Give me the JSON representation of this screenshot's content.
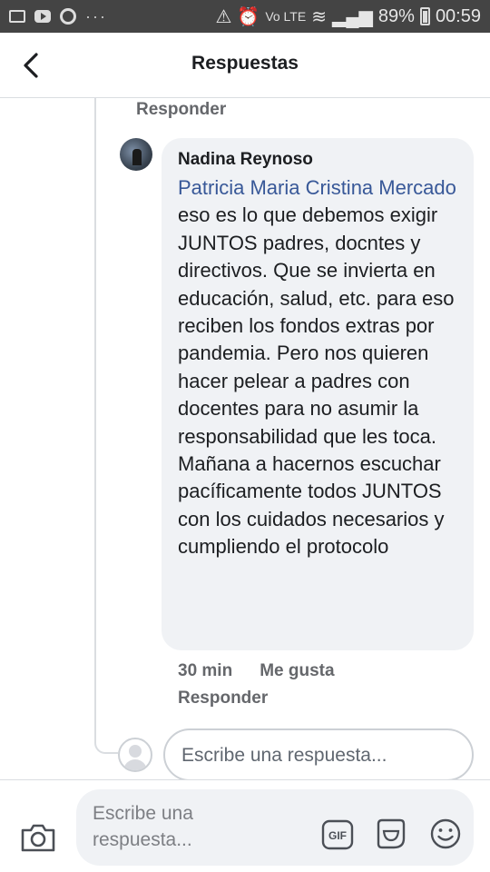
{
  "status_bar": {
    "dots": "···",
    "battery_percent": "89%",
    "time": "00:59",
    "volte": "Vo LTE"
  },
  "header": {
    "title": "Respuestas"
  },
  "thread": {
    "reply_label_top": "Responder",
    "comment": {
      "author": "Nadina Reynoso",
      "mention": "Patricia Maria Cristina Mercado",
      "text": "  eso es lo que debemos  exigir JUNTOS padres, docntes y directivos. Que se invierta en educación, salud, etc. para eso reciben los fondos extras por pandemia. Pero nos quieren hacer pelear a padres con docentes para no asumir la responsabilidad que les toca. Mañana a hacernos escuchar pacíficamente todos JUNTOS con los cuidados necesarios y cumpliendo  el protocolo",
      "time": "30 min",
      "like_label": "Me gusta",
      "reply_label": "Responder"
    },
    "inline_reply_placeholder": "Escribe una respuesta..."
  },
  "composer": {
    "placeholder": "Escribe una\nrespuesta...",
    "gif_label": "GIF"
  }
}
